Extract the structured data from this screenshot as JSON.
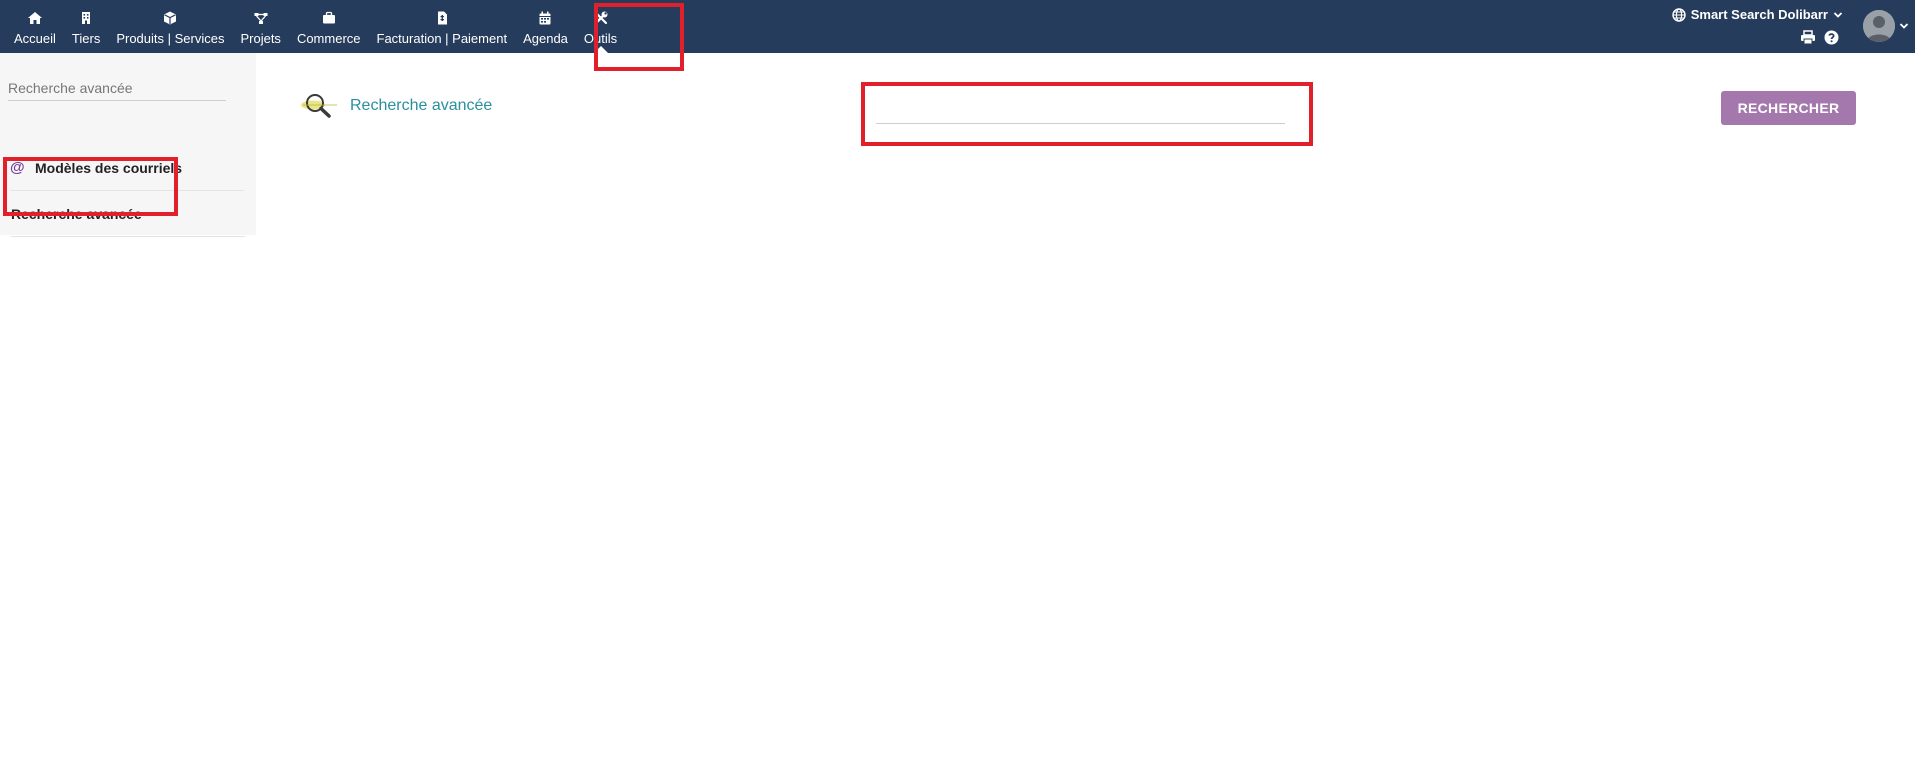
{
  "nav": {
    "items": [
      {
        "label": "Accueil",
        "icon": "home-icon"
      },
      {
        "label": "Tiers",
        "icon": "building-icon"
      },
      {
        "label": "Produits | Services",
        "icon": "cube-icon"
      },
      {
        "label": "Projets",
        "icon": "project-tree-icon"
      },
      {
        "label": "Commerce",
        "icon": "briefcase-icon"
      },
      {
        "label": "Facturation | Paiement",
        "icon": "invoice-icon"
      },
      {
        "label": "Agenda",
        "icon": "calendar-icon"
      },
      {
        "label": "Outils",
        "icon": "tools-icon",
        "active": true
      }
    ]
  },
  "header": {
    "entity_name": "Smart Search Dolibarr",
    "entity_icon": "globe-icon",
    "print_icon": "print-icon",
    "help_icon": "help-icon",
    "user_icon": "user-avatar"
  },
  "sidebar": {
    "search_placeholder": "Recherche avancée",
    "items": [
      {
        "label": "Modèles des courriels",
        "icon": "at-icon",
        "icon_glyph": "@"
      },
      {
        "label": "Recherche avancée"
      }
    ]
  },
  "main": {
    "title": "Recherche avancée",
    "title_icon": "magnifier-logo-icon",
    "search_value": "",
    "search_button_label": "RECHERCHER"
  },
  "colors": {
    "topbar": "#263c5c",
    "highlight": "#e0202a",
    "link": "#2a8f9f",
    "button": "#a478ad"
  }
}
